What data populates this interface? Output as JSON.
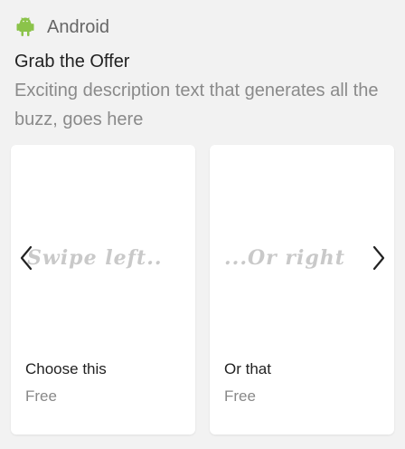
{
  "notification": {
    "app_name": "Android",
    "title": "Grab the Offer",
    "description": "Exciting description text that generates all the buzz, goes here"
  },
  "cards": [
    {
      "swipe_text": "Swipe left..",
      "title": "Choose this",
      "price": "Free"
    },
    {
      "swipe_text": "...Or right",
      "title": "Or that",
      "price": "Free"
    }
  ],
  "icons": {
    "app": "android-icon",
    "previous": "chevron-left-icon",
    "next": "chevron-right-icon"
  },
  "colors": {
    "android": "#8bc34a"
  }
}
